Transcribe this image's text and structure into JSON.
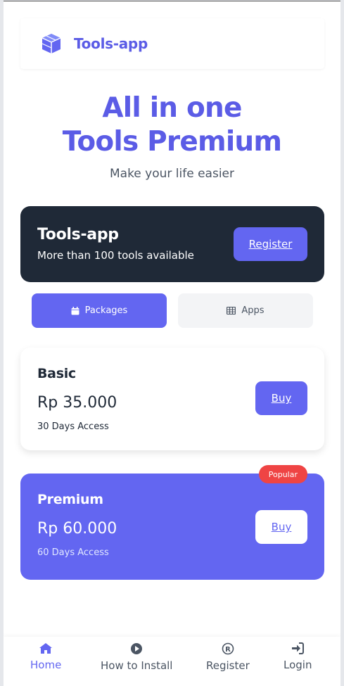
{
  "header": {
    "brand": "Tools-app",
    "logo_icon": "cube-icon"
  },
  "hero": {
    "title_line1": "All in one",
    "title_line2": "Tools Premium",
    "subtitle": "Make your life easier"
  },
  "promo": {
    "title": "Tools-app",
    "description": "More than 100 tools available",
    "register_label": "Register"
  },
  "tabs": [
    {
      "label": "Packages",
      "icon": "calendar-icon",
      "active": true
    },
    {
      "label": "Apps",
      "icon": "table-icon",
      "active": false
    }
  ],
  "plans": [
    {
      "name": "Basic",
      "price": "Rp 35.000",
      "access": "30 Days Access",
      "buy_label": "Buy"
    },
    {
      "name": "Premium",
      "price": "Rp 60.000",
      "access": "60 Days Access",
      "buy_label": "Buy",
      "badge": "Popular"
    }
  ],
  "nav": [
    {
      "label": "Home",
      "icon": "home-icon",
      "active": true
    },
    {
      "label": "How to Install",
      "icon": "play-circle-icon"
    },
    {
      "label": "Register",
      "icon": "registered-icon"
    },
    {
      "label": "Login",
      "icon": "sign-in-icon"
    }
  ],
  "colors": {
    "accent": "#6366f1",
    "brand_text": "#5b5ce6",
    "dark_card": "#1f2937",
    "badge": "#ef4444"
  }
}
